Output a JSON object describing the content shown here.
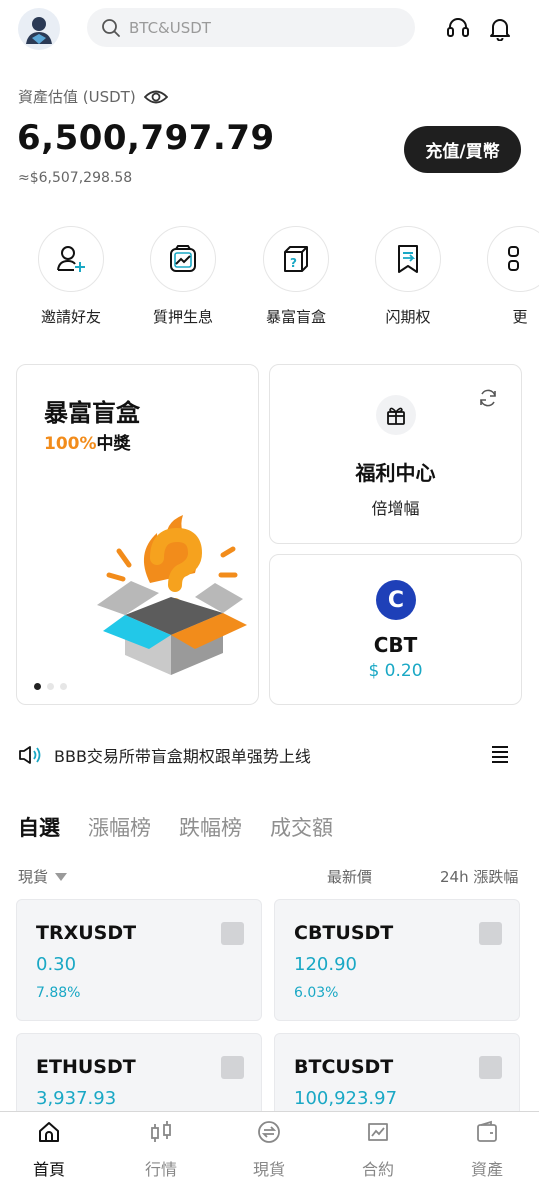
{
  "header": {
    "search_placeholder": "BTC&USDT"
  },
  "asset": {
    "label": "資產估值 (USDT)",
    "value": "6,500,797.79",
    "sub_value": "≈$6,507,298.58",
    "deposit_label": "充值/買幣"
  },
  "quick_actions": [
    {
      "label": "邀請好友",
      "icon": "add-user-icon"
    },
    {
      "label": "質押生息",
      "icon": "stake-chart-icon"
    },
    {
      "label": "暴富盲盒",
      "icon": "mystery-box-icon"
    },
    {
      "label": "闪期权",
      "icon": "flash-option-icon"
    },
    {
      "label": "更",
      "icon": "more-grid-icon"
    }
  ],
  "blind_box_card": {
    "title": "暴富盲盒",
    "highlight": "100%",
    "sub": "中獎"
  },
  "welfare_card": {
    "title": "福利中心",
    "sub": "倍增幅"
  },
  "cbt_card": {
    "name": "CBT",
    "price": "$ 0.20",
    "logo_letter": "C"
  },
  "announcement": {
    "text": "BBB交易所带盲盒期权跟单强势上线"
  },
  "tabs": [
    "自選",
    "漲幅榜",
    "跌幅榜",
    "成交額"
  ],
  "columns": {
    "type": "現貨",
    "latest_price": "最新價",
    "change_24h": "24h 漲跌幅"
  },
  "tiles": [
    {
      "symbol": "TRXUSDT",
      "price": "0.30",
      "change": "7.88%"
    },
    {
      "symbol": "CBTUSDT",
      "price": "120.90",
      "change": "6.03%"
    },
    {
      "symbol": "ETHUSDT",
      "price": "3,937.93",
      "change": ""
    },
    {
      "symbol": "BTCUSDT",
      "price": "100,923.97",
      "change": ""
    }
  ],
  "bottom_nav": [
    {
      "label": "首頁",
      "icon": "home-icon",
      "active": true
    },
    {
      "label": "行情",
      "icon": "candlestick-icon",
      "active": false
    },
    {
      "label": "現貨",
      "icon": "exchange-icon",
      "active": false
    },
    {
      "label": "合約",
      "icon": "contract-chart-icon",
      "active": false
    },
    {
      "label": "資產",
      "icon": "wallet-icon",
      "active": false
    }
  ],
  "colors": {
    "accent_teal": "#1aa8c5",
    "highlight_orange": "#f28c1b",
    "button_dark": "#1f1f1f",
    "cbt_blue": "#1e40b8"
  }
}
